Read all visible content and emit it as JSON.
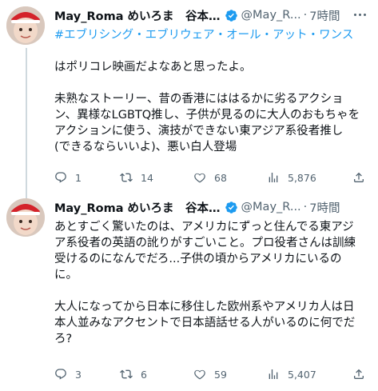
{
  "tweets": [
    {
      "author_name": "May_Roma めいろま　谷本…",
      "handle": "@May_R...",
      "time": "7時間",
      "hashtag": "#エブリシング・エブリウェア・オール・アット・ワンス",
      "paragraphs": [
        "はポリコレ映画だよなあと思ったよ。",
        "未熟なストーリー、昔の香港にははるかに劣るアクショ\nン、異様なLGBTQ推し、子供が見るのに大人のおもちゃを\nアクションに使う、演技ができない東アジア系役者推し\n(できるならいいよ)、悪い白人登場"
      ],
      "replies": "1",
      "retweets": "14",
      "likes": "68",
      "views": "5,876"
    },
    {
      "author_name": "May_Roma めいろま　谷本…",
      "handle": "@May_R...",
      "time": "7時間",
      "paragraphs": [
        "あとすごく驚いたのは、アメリカにずっと住んでる東アジ\nア系役者の英語の訛りがすごいこと。プロ役者さんは訓練\n受けるのになんでだろ...子供の頃からアメリカにいるの\nに。",
        "大人になってから日本に移住した欧州系やアメリカ人は日\n本人並みなアクセントで日本語話せる人がいるのに何でだ\nろ?"
      ],
      "replies": "3",
      "retweets": "6",
      "likes": "59",
      "views": "5,407"
    }
  ],
  "icons": {
    "verified": "verified-badge-icon",
    "reply": "reply-icon",
    "retweet": "retweet-icon",
    "like": "like-icon",
    "views": "views-icon",
    "share": "share-icon",
    "more": "more-icon"
  },
  "colors": {
    "link": "#1d9bf0",
    "muted": "#536471",
    "text": "#0f1419",
    "thread_line": "#cfd9de"
  }
}
